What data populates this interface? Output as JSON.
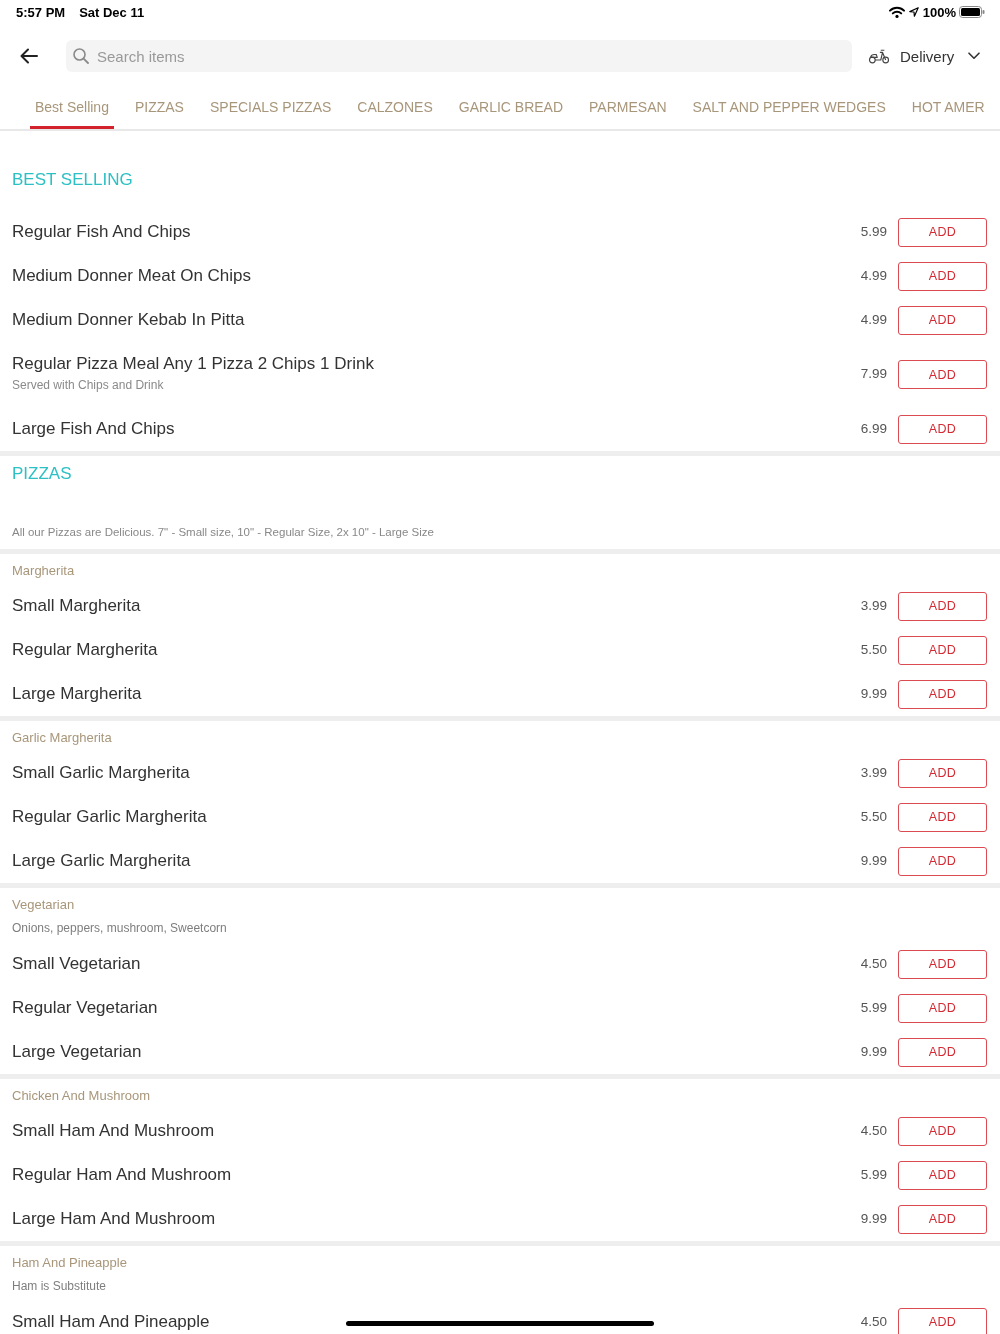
{
  "status_bar": {
    "time": "5:57 PM",
    "date": "Sat Dec 11",
    "battery_text": "100%"
  },
  "header": {
    "search": {
      "placeholder": "Search items"
    },
    "order_mode": "Delivery"
  },
  "tabs": [
    {
      "label": "Best Selling",
      "selected": true
    },
    {
      "label": "PIZZAS",
      "selected": false
    },
    {
      "label": "SPECIALS PIZZAS",
      "selected": false
    },
    {
      "label": "CALZONES",
      "selected": false
    },
    {
      "label": "GARLIC BREAD",
      "selected": false
    },
    {
      "label": "PARMESAN",
      "selected": false
    },
    {
      "label": "SALT AND PEPPER WEDGES",
      "selected": false
    },
    {
      "label": "HOT AMER",
      "selected": false
    }
  ],
  "sections": [
    {
      "title": "BEST SELLING",
      "groups": [
        {
          "items": [
            {
              "name": "Regular Fish And Chips",
              "price": "5.99",
              "action": "ADD"
            },
            {
              "name": "Medium Donner Meat On Chips",
              "price": "4.99",
              "action": "ADD"
            },
            {
              "name": "Medium Donner Kebab In Pitta",
              "price": "4.99",
              "action": "ADD"
            },
            {
              "name": "Regular Pizza Meal Any 1 Pizza 2 Chips 1 Drink",
              "description": "Served with Chips and Drink",
              "price": "7.99",
              "action": "ADD"
            },
            {
              "name": "Large Fish And Chips",
              "price": "6.99",
              "action": "ADD"
            }
          ]
        }
      ]
    },
    {
      "title": "PIZZAS",
      "description": "All our Pizzas are Delicious. 7\" - Small size, 10\" - Regular Size, 2x 10\" - Large Size",
      "groups": [
        {
          "name": "Margherita",
          "items": [
            {
              "name": "Small Margherita",
              "price": "3.99",
              "action": "ADD"
            },
            {
              "name": "Regular Margherita",
              "price": "5.50",
              "action": "ADD"
            },
            {
              "name": "Large Margherita",
              "price": "9.99",
              "action": "ADD"
            }
          ]
        },
        {
          "name": "Garlic Margherita",
          "items": [
            {
              "name": "Small Garlic Margherita",
              "price": "3.99",
              "action": "ADD"
            },
            {
              "name": "Regular Garlic Margherita",
              "price": "5.50",
              "action": "ADD"
            },
            {
              "name": "Large Garlic Margherita",
              "price": "9.99",
              "action": "ADD"
            }
          ]
        },
        {
          "name": "Vegetarian",
          "description": "Onions, peppers, mushroom, Sweetcorn",
          "items": [
            {
              "name": "Small Vegetarian",
              "price": "4.50",
              "action": "ADD"
            },
            {
              "name": "Regular Vegetarian",
              "price": "5.99",
              "action": "ADD"
            },
            {
              "name": "Large Vegetarian",
              "price": "9.99",
              "action": "ADD"
            }
          ]
        },
        {
          "name": "Chicken And Mushroom",
          "items": [
            {
              "name": "Small Ham And Mushroom",
              "price": "4.50",
              "action": "ADD"
            },
            {
              "name": "Regular Ham And Mushroom",
              "price": "5.99",
              "action": "ADD"
            },
            {
              "name": "Large Ham And Mushroom",
              "price": "9.99",
              "action": "ADD"
            }
          ]
        },
        {
          "name": "Ham And Pineapple",
          "description": "Ham is Substitute",
          "items": [
            {
              "name": "Small Ham And Pineapple",
              "price": "4.50",
              "action": "ADD"
            }
          ]
        }
      ]
    }
  ]
}
